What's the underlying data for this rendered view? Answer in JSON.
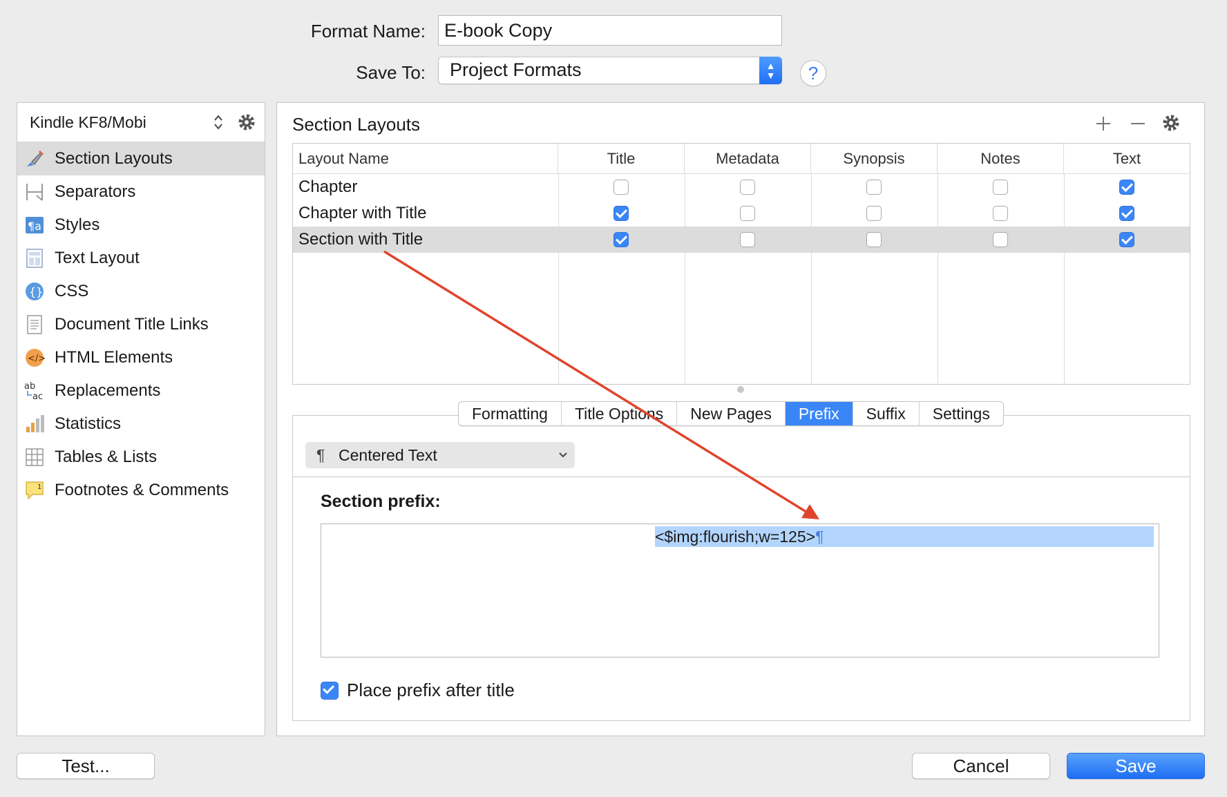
{
  "form": {
    "format_name_label": "Format Name:",
    "format_name_value": "E-book Copy",
    "save_to_label": "Save To:",
    "save_to_value": "Project Formats",
    "help_label": "?"
  },
  "sidebar": {
    "format_selector": "Kindle KF8/Mobi",
    "items": [
      {
        "label": "Section Layouts",
        "icon": "brush-icon",
        "selected": true
      },
      {
        "label": "Separators",
        "icon": "separator-icon"
      },
      {
        "label": "Styles",
        "icon": "styles-icon"
      },
      {
        "label": "Text Layout",
        "icon": "layout-icon"
      },
      {
        "label": "CSS",
        "icon": "css-icon"
      },
      {
        "label": "Document Title Links",
        "icon": "document-icon"
      },
      {
        "label": "HTML Elements",
        "icon": "html-icon"
      },
      {
        "label": "Replacements",
        "icon": "replacements-icon"
      },
      {
        "label": "Statistics",
        "icon": "bar-chart-icon"
      },
      {
        "label": "Tables & Lists",
        "icon": "table-icon"
      },
      {
        "label": "Footnotes & Comments",
        "icon": "comment-icon"
      }
    ]
  },
  "panel": {
    "title": "Section Layouts",
    "columns": [
      "Layout Name",
      "Title",
      "Metadata",
      "Synopsis",
      "Notes",
      "Text"
    ],
    "rows": [
      {
        "name": "Chapter",
        "checks": [
          false,
          false,
          false,
          false,
          true
        ]
      },
      {
        "name": "Chapter with Title",
        "checks": [
          true,
          false,
          false,
          false,
          true
        ]
      },
      {
        "name": "Section with Title",
        "checks": [
          true,
          false,
          false,
          false,
          true
        ],
        "selected": true
      }
    ],
    "tabs": [
      "Formatting",
      "Title Options",
      "New Pages",
      "Prefix",
      "Suffix",
      "Settings"
    ],
    "active_tab": "Prefix",
    "paragraph_style": "Centered Text",
    "paragraph_glyph": "¶",
    "prefix_label": "Section prefix:",
    "prefix_value": "<$img:flourish;w=125>",
    "pilcrow": "¶",
    "place_after_title_label": "Place prefix after title",
    "place_after_title_checked": true
  },
  "buttons": {
    "test": "Test...",
    "cancel": "Cancel",
    "save": "Save"
  },
  "colors": {
    "accent": "#3b86f7",
    "selection": "#b3d5fd",
    "annotation_arrow": "#e0452c"
  }
}
